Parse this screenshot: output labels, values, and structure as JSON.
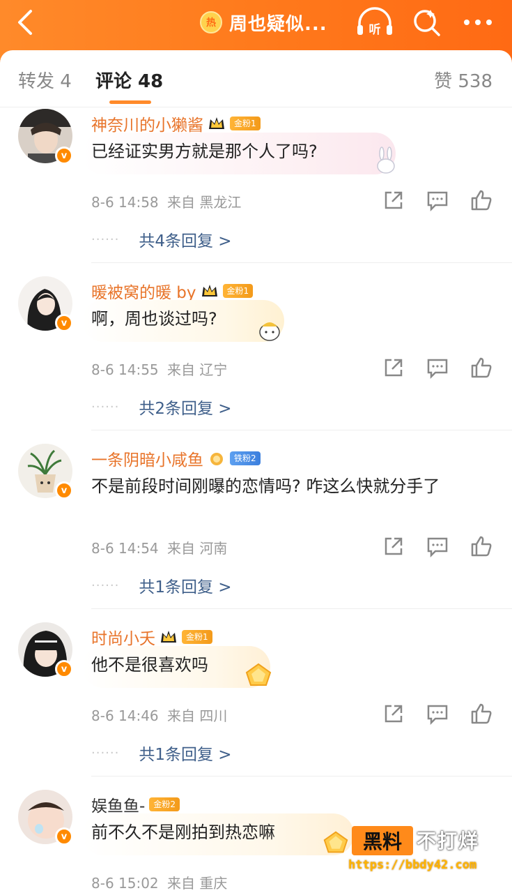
{
  "header": {
    "hot_badge": "热",
    "title": "周也疑似...",
    "listen_label": "听",
    "bg_color": "#ff7a1c"
  },
  "tabs": {
    "repost": "转发 4",
    "comments": "评论 48",
    "likes": "赞 538",
    "active": "comments"
  },
  "comments": [
    {
      "name": "神奈川的小獭酱",
      "fan_badge": "金粉1",
      "text": "已经证实男方就是那个人了吗?",
      "time": "8-6 14:58",
      "location": "来自 黑龙江",
      "replies": "共4条回复 >",
      "dots": "······",
      "avatar_icon": "user-photo"
    },
    {
      "name": "暖被窝的暖 by",
      "fan_badge": "金粉1",
      "text": "啊，周也谈过吗?",
      "time": "8-6 14:55",
      "location": "来自 辽宁",
      "replies": "共2条回复 >",
      "dots": "······",
      "avatar_icon": "illustrated-girl"
    },
    {
      "name": "一条阴暗小咸鱼",
      "fan_badge": "铁粉2",
      "text": "不是前段时间刚曝的恋情吗? 咋这么快就分手了",
      "time": "8-6 14:54",
      "location": "来自 河南",
      "replies": "共1条回复 >",
      "dots": "······",
      "avatar_icon": "potted-plant"
    },
    {
      "name": "时尚小夭",
      "fan_badge": "金粉1",
      "text": "他不是很喜欢吗",
      "time": "8-6 14:46",
      "location": "来自 四川",
      "replies": "共1条回复 >",
      "dots": "······",
      "avatar_icon": "illustrated-girl-bangs"
    },
    {
      "name": "娱鱼鱼-",
      "fan_badge": "金粉2",
      "text": "前不久不是刚拍到热恋嘛",
      "time": "8-6 15:02",
      "location": "来自 重庆",
      "avatar_icon": "baby-photo"
    }
  ],
  "watermark": {
    "box": "黑料",
    "text": "不打烊",
    "url": "https://bbdy42.com"
  },
  "colors": {
    "accent": "#ff8a2a",
    "username": "#e8742a",
    "reply_link": "#3f5f8a"
  }
}
